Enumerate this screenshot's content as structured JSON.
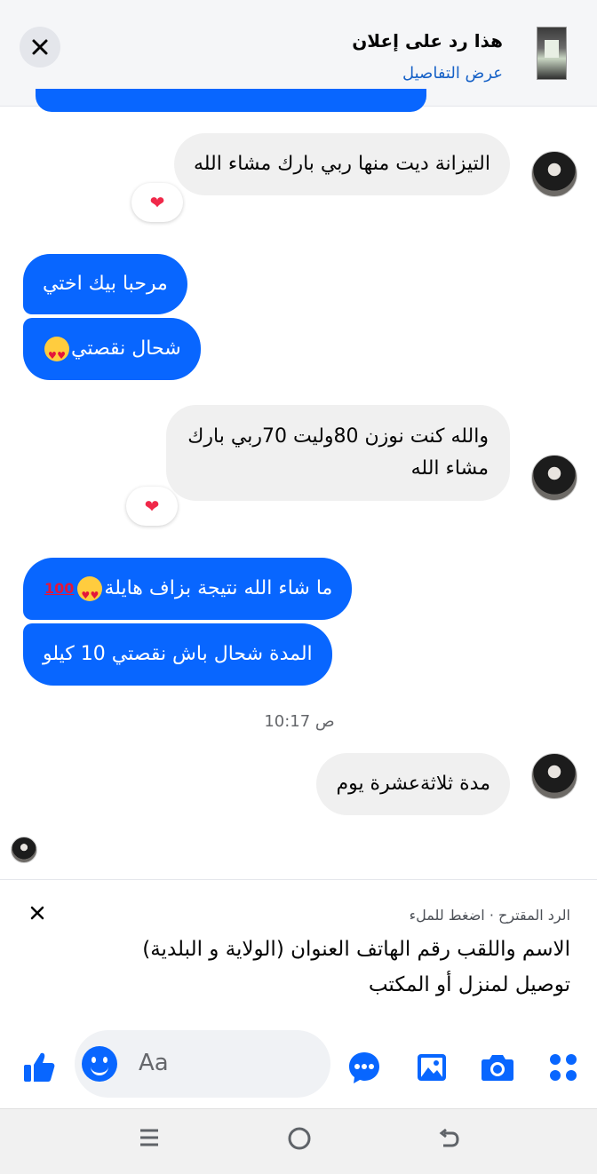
{
  "header": {
    "title": "هذا رد على إعلان",
    "link": "عرض التفاصيل",
    "close_icon": "close-icon"
  },
  "messages": [
    {
      "side": "in",
      "text": "التيزانة ديت منها ربي بارك مشاء الله",
      "reaction": "❤"
    },
    {
      "side": "out",
      "text": "مرحبا بيك اختي"
    },
    {
      "side": "out",
      "text": "شحال نقصتي",
      "emoji": "heart-eyes"
    },
    {
      "side": "in",
      "text_line1": "والله كنت نوزن 80وليت 70ربي بارك",
      "text_line2": "مشاء الله",
      "reaction": "❤"
    },
    {
      "side": "out",
      "text": "ما شاء الله نتيجة بزاف هايلة",
      "emoji": "heart-eyes 100"
    },
    {
      "side": "out",
      "text": "المدة شحال باش نقصتي 10 كيلو"
    },
    {
      "side": "in",
      "text": "مدة ثلاثةعشرة يوم"
    }
  ],
  "timestamp": "10:17 ص",
  "suggested_reply": {
    "meta": "الرد المقترح · اضغط للملء",
    "text_line1": "الاسم واللقب رقم الهاتف العنوان (الولاية و البلدية)",
    "text_line2": "توصيل لمنزل أو المكتب"
  },
  "composer": {
    "placeholder": "Aa"
  },
  "colors": {
    "accent": "#0866ff",
    "incoming_bubble": "#f0f0f0"
  }
}
